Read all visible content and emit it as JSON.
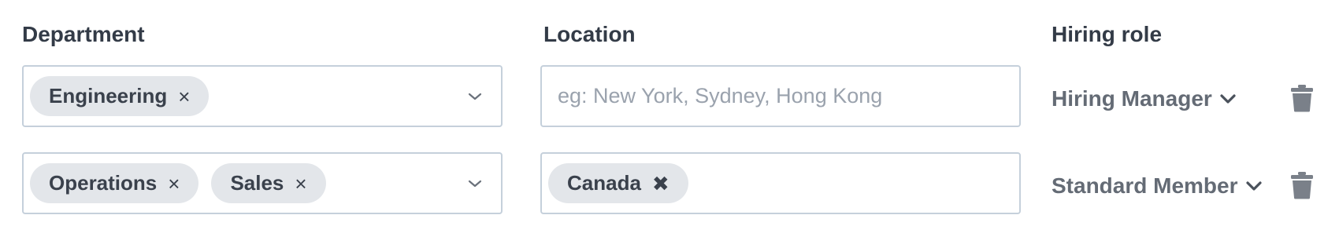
{
  "headers": {
    "department": "Department",
    "location": "Location",
    "hiring_role": "Hiring role"
  },
  "location_placeholder": "eg: New York, Sydney, Hong Kong",
  "rows": [
    {
      "departments": [
        "Engineering"
      ],
      "locations": [],
      "hiring_role": "Hiring Manager"
    },
    {
      "departments": [
        "Operations",
        "Sales"
      ],
      "locations": [
        "Canada"
      ],
      "hiring_role": "Standard Member"
    }
  ],
  "icons": {
    "chip_remove": "×",
    "location_chip_remove": "✖",
    "dropdown": "chevron-down-icon",
    "delete": "trash-icon"
  },
  "colors": {
    "chip_bg": "#e3e6ea",
    "border": "#c5d0db",
    "muted_text": "#646b75",
    "placeholder": "#9aa2ad",
    "trash": "#7a8089"
  }
}
